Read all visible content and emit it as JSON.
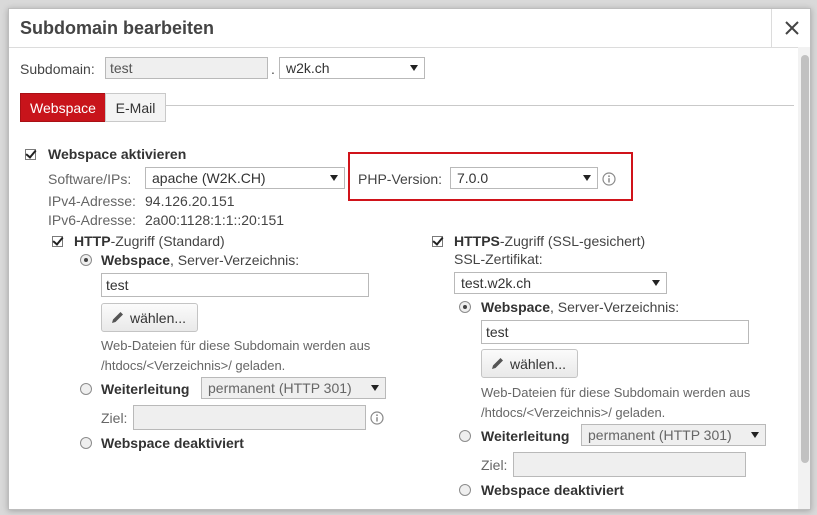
{
  "dialog": {
    "title": "Subdomain bearbeiten"
  },
  "subdomain": {
    "label": "Subdomain:",
    "value": "test",
    "separator": ".",
    "domain": "w2k.ch"
  },
  "tabs": [
    {
      "label": "Webspace",
      "active": true
    },
    {
      "label": "E-Mail",
      "active": false
    }
  ],
  "webspace": {
    "enable_label": "Webspace aktivieren",
    "software_label": "Software/IPs:",
    "software_value": "apache (W2K.CH)",
    "php_label": "PHP-Version:",
    "php_value": "7.0.0",
    "ipv4_label": "IPv4-Adresse:",
    "ipv4_value": "94.126.20.151",
    "ipv6_label": "IPv6-Adresse:",
    "ipv6_value": "2a00:1128:1:1::20:151"
  },
  "http": {
    "title_bold": "HTTP",
    "title_rest": "-Zugriff (Standard)",
    "webspace_bold": "Webspace",
    "webspace_rest": ", Server-Verzeichnis:",
    "dir_value": "test",
    "choose_label": "wählen...",
    "help_line1": "Web-Dateien für diese Subdomain werden aus",
    "help_line2": "/htdocs/<Verzeichnis>/ geladen.",
    "redirect_label": "Weiterleitung",
    "redirect_value": "permanent (HTTP 301)",
    "target_label": "Ziel:",
    "disabled_label": "Webspace deaktiviert"
  },
  "https": {
    "title_bold": "HTTPS",
    "title_rest": "-Zugriff (SSL-gesichert)",
    "ssl_label": "SSL-Zertifikat:",
    "ssl_value": "test.w2k.ch",
    "webspace_bold": "Webspace",
    "webspace_rest": ", Server-Verzeichnis:",
    "dir_value": "test",
    "choose_label": "wählen...",
    "help_line1": "Web-Dateien für diese Subdomain werden aus",
    "help_line2": "/htdocs/<Verzeichnis>/ geladen.",
    "redirect_label": "Weiterleitung",
    "redirect_value": "permanent (HTTP 301)",
    "target_label": "Ziel:",
    "disabled_label": "Webspace deaktiviert"
  },
  "colors": {
    "accent": "#c8141b",
    "highlight": "#d0131a"
  },
  "icons": {
    "close": "close-icon",
    "caret": "caret-down-icon",
    "info": "info-icon",
    "pencil": "pencil-icon"
  }
}
